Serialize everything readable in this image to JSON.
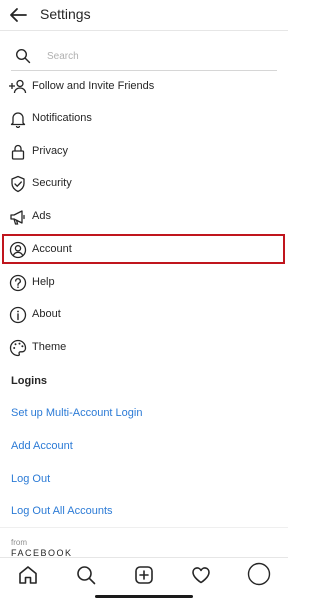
{
  "header": {
    "title": "Settings",
    "back_icon": "back-arrow-icon"
  },
  "search": {
    "placeholder": "Search",
    "value": ""
  },
  "menu": [
    {
      "label": "Follow and Invite Friends",
      "icon": "add-person-icon"
    },
    {
      "label": "Notifications",
      "icon": "bell-icon"
    },
    {
      "label": "Privacy",
      "icon": "lock-icon"
    },
    {
      "label": "Security",
      "icon": "shield-check-icon"
    },
    {
      "label": "Ads",
      "icon": "megaphone-icon"
    },
    {
      "label": "Account",
      "icon": "person-circle-icon",
      "highlighted": true
    },
    {
      "label": "Help",
      "icon": "help-circle-icon"
    },
    {
      "label": "About",
      "icon": "info-circle-icon"
    },
    {
      "label": "Theme",
      "icon": "palette-icon"
    }
  ],
  "logins": {
    "heading": "Logins",
    "links": [
      "Set up Multi-Account Login",
      "Add Account",
      "Log Out",
      "Log Out All Accounts"
    ]
  },
  "footer": {
    "from": "from",
    "brand": "FACEBOOK"
  },
  "tabbar": [
    "home-icon",
    "search-icon",
    "new-post-icon",
    "heart-icon",
    "profile-icon"
  ],
  "colors": {
    "link": "#2c7bd6",
    "highlight": "#c0151d",
    "text": "#262626"
  }
}
